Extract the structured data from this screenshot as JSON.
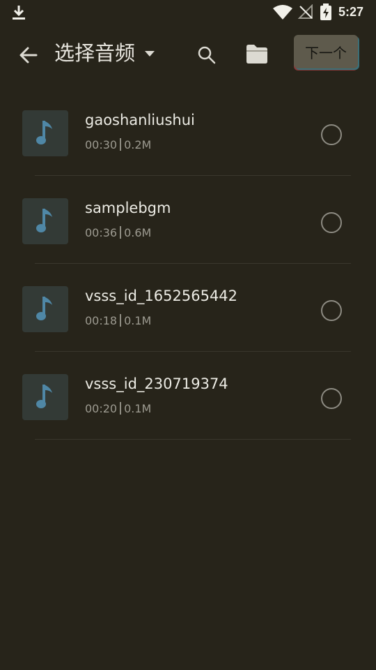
{
  "status_bar": {
    "time": "5:27",
    "icons": [
      "download-icon",
      "wifi-icon",
      "signal-off-icon",
      "battery-charging-icon"
    ]
  },
  "toolbar": {
    "title": "选择音频",
    "next_label": "下一个",
    "icons": [
      "arrow-back-icon",
      "caret-down-icon",
      "search-icon",
      "folder-icon"
    ]
  },
  "tracks": [
    {
      "name": "gaoshanliushui",
      "duration": "00:30",
      "size": "0.2M",
      "icon": "music-note-icon"
    },
    {
      "name": "samplebgm",
      "duration": "00:36",
      "size": "0.6M",
      "icon": "music-note-icon"
    },
    {
      "name": "vsss_id_1652565442",
      "duration": "00:18",
      "size": "0.1M",
      "icon": "music-note-icon"
    },
    {
      "name": "vsss_id_230719374",
      "duration": "00:20",
      "size": "0.1M",
      "icon": "music-note-icon"
    }
  ],
  "colors": {
    "background": "#27241a",
    "thumb_bg": "#333a36",
    "note": "#4f87a6",
    "next_button_bg": "#5e5a4c"
  }
}
